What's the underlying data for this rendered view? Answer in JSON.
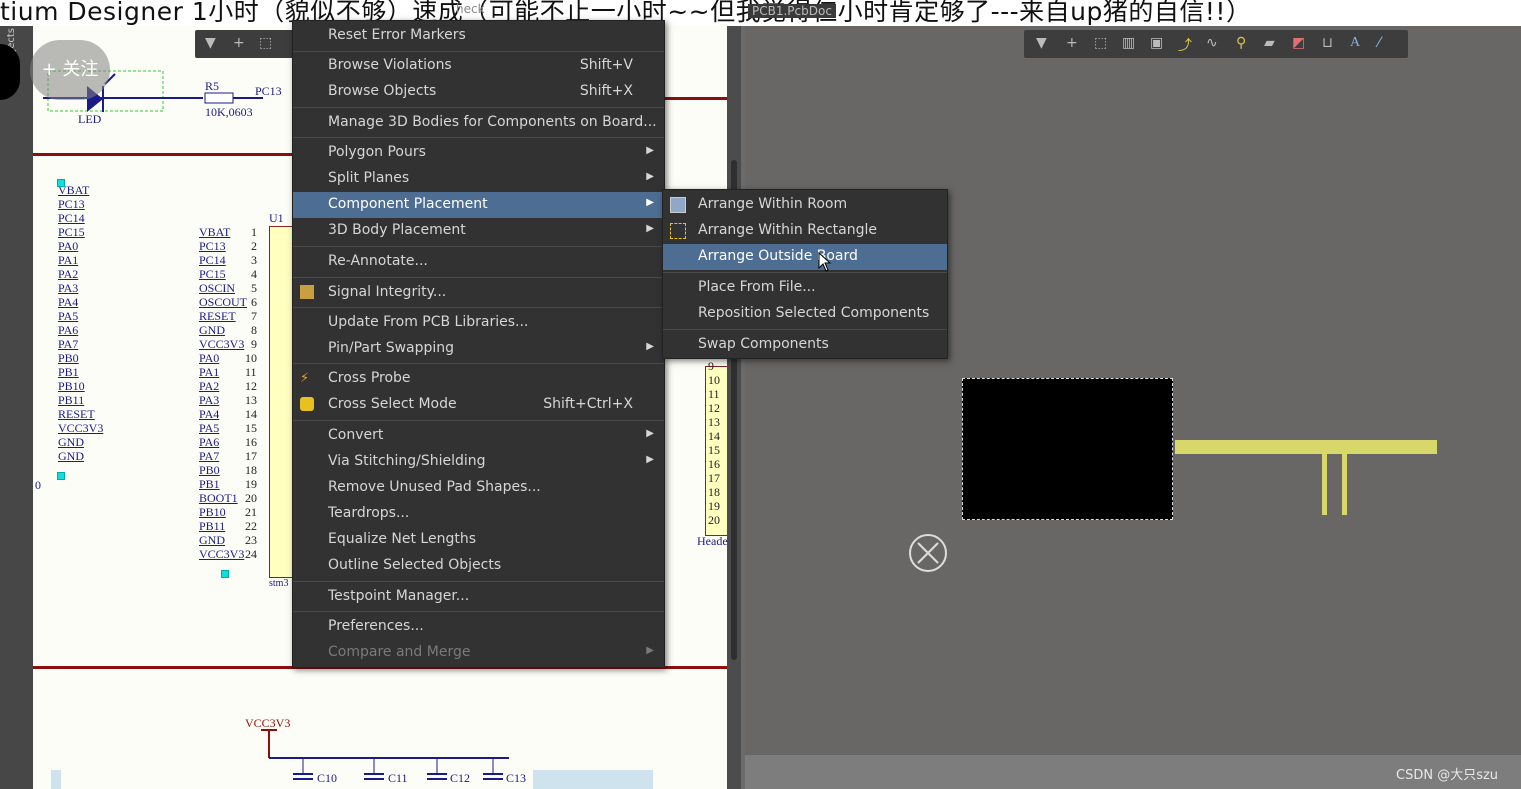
{
  "banner": {
    "title": "tium Designer 1小时（貌似不够）速成（可能不止一小时~~但我觉得仨小时肯定够了---来自up猪的自信!!）",
    "tab_left": "heck",
    "tab_right": "PCB1.PcbDoc"
  },
  "left_panel": {
    "label": "Objects"
  },
  "overlay": {
    "follow_label": "+ 关注"
  },
  "schematic": {
    "led_label": "LED",
    "resistor_ref": "R5",
    "resistor_value": "10K,0603",
    "net_pc13": "PC13",
    "ic_ref": "U1",
    "ic_name": "stm3",
    "header_name": "Heade",
    "power_label": "VCC3V3",
    "left_nets": [
      "VBAT",
      "PC13",
      "PC14",
      "PC15",
      "PA0",
      "PA1",
      "PA2",
      "PA3",
      "PA4",
      "PA5",
      "PA6",
      "PA7",
      "PB0",
      "PB1",
      "PB10",
      "PB11",
      "RESET",
      "VCC3V3",
      "GND",
      "GND"
    ],
    "ic_nets": [
      "VBAT",
      "PC13",
      "PC14",
      "PC15",
      "OSCIN",
      "OSCOUT",
      "RESET",
      "GND",
      "VCC3V3",
      "PA0",
      "PA1",
      "PA2",
      "PA3",
      "PA4",
      "PA5",
      "PA6",
      "PA7",
      "PB0",
      "PB1",
      "BOOT1",
      "PB10",
      "PB11",
      "GND",
      "VCC3V3"
    ],
    "ic_pins": [
      "1",
      "2",
      "3",
      "4",
      "5",
      "6",
      "7",
      "8",
      "9",
      "10",
      "11",
      "12",
      "13",
      "14",
      "15",
      "16",
      "17",
      "18",
      "19",
      "20",
      "21",
      "22",
      "23",
      "24"
    ],
    "header_pins": [
      "9",
      "10",
      "11",
      "12",
      "13",
      "14",
      "15",
      "16",
      "17",
      "18",
      "19",
      "20"
    ],
    "caps": [
      "C10",
      "C11",
      "C12",
      "C13"
    ],
    "stray_zero": "0"
  },
  "menu": {
    "items": [
      {
        "label": "Reset Error Markers",
        "shortcut": "",
        "submenu": false
      },
      {
        "label": "Browse Violations",
        "shortcut": "Shift+V",
        "submenu": false
      },
      {
        "label": "Browse Objects",
        "shortcut": "Shift+X",
        "submenu": false
      },
      {
        "label": "Manage 3D Bodies for Components on Board...",
        "shortcut": "",
        "submenu": false
      },
      {
        "label": "Polygon Pours",
        "shortcut": "",
        "submenu": true
      },
      {
        "label": "Split Planes",
        "shortcut": "",
        "submenu": true
      },
      {
        "label": "Component Placement",
        "shortcut": "",
        "submenu": true
      },
      {
        "label": "3D Body Placement",
        "shortcut": "",
        "submenu": true
      },
      {
        "label": "Re-Annotate...",
        "shortcut": "",
        "submenu": false
      },
      {
        "label": "Signal Integrity...",
        "shortcut": "",
        "submenu": false
      },
      {
        "label": "Update From PCB Libraries...",
        "shortcut": "",
        "submenu": false
      },
      {
        "label": "Pin/Part Swapping",
        "shortcut": "",
        "submenu": true
      },
      {
        "label": "Cross Probe",
        "shortcut": "",
        "submenu": false
      },
      {
        "label": "Cross Select Mode",
        "shortcut": "Shift+Ctrl+X",
        "submenu": false
      },
      {
        "label": "Convert",
        "shortcut": "",
        "submenu": true
      },
      {
        "label": "Via Stitching/Shielding",
        "shortcut": "",
        "submenu": true
      },
      {
        "label": "Remove Unused Pad Shapes...",
        "shortcut": "",
        "submenu": false
      },
      {
        "label": "Teardrops...",
        "shortcut": "",
        "submenu": false
      },
      {
        "label": "Equalize Net Lengths",
        "shortcut": "",
        "submenu": false
      },
      {
        "label": "Outline Selected Objects",
        "shortcut": "",
        "submenu": false
      },
      {
        "label": "Testpoint Manager...",
        "shortcut": "",
        "submenu": false
      },
      {
        "label": "Preferences...",
        "shortcut": "",
        "submenu": false
      },
      {
        "label": "Compare and Merge",
        "shortcut": "",
        "submenu": true
      }
    ],
    "highlighted": "Component Placement",
    "disabled": "Compare and Merge"
  },
  "submenu": {
    "items": [
      {
        "label": "Arrange Within Room"
      },
      {
        "label": "Arrange Within Rectangle"
      },
      {
        "label": "Arrange Outside Board"
      },
      {
        "label": "Place From File..."
      },
      {
        "label": "Reposition Selected Components"
      },
      {
        "label": "Swap Components"
      }
    ],
    "highlighted": "Arrange Outside Board"
  },
  "watermark": "CSDN @大只szu",
  "colors": {
    "menu_bg": "#323233",
    "highlight": "#4e6d92",
    "schematic_bg": "#fdfdf7",
    "pcb_bg": "#696765",
    "component": "#d8d86a"
  }
}
